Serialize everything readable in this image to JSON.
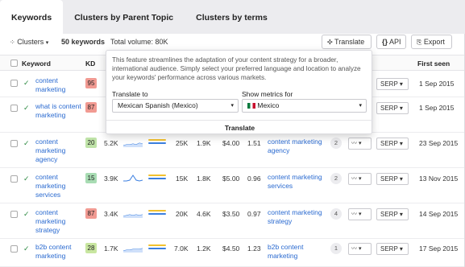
{
  "tabs": [
    {
      "label": "Keywords",
      "active": true
    },
    {
      "label": "Clusters by Parent Topic",
      "active": false
    },
    {
      "label": "Clusters by terms",
      "active": false
    }
  ],
  "toolbar": {
    "clusters_label": "Clusters",
    "keywords_count": "50 keywords",
    "total_volume": "Total volume: 80K",
    "translate_label": "Translate",
    "api_label": "API",
    "export_label": "Export"
  },
  "columns": {
    "keyword": "Keyword",
    "kd": "KD",
    "first_seen": "First seen"
  },
  "rows": [
    {
      "keyword": "content marketing",
      "kd": "95",
      "kd_color": "#f19a92",
      "volume": "",
      "clicks": "",
      "cps": "",
      "cpc": "",
      "parent": "",
      "parent_count": "",
      "serp": "SERP",
      "date": "1 Sep 2015"
    },
    {
      "keyword": "what is content marketing",
      "kd": "87",
      "kd_color": "#f19a92",
      "volume": "",
      "clicks": "",
      "cps": "",
      "cpc": "",
      "parent": "",
      "parent_count": "",
      "serp": "SERP",
      "date": "1 Sep 2015"
    },
    {
      "keyword": "content marketing agency",
      "kd": "20",
      "kd_color": "#bfe3a8",
      "cpc_val": "5.2K",
      "volume": "25K",
      "clicks": "1.9K",
      "cpc": "$4.00",
      "cps": "1.51",
      "parent": "content marketing agency",
      "parent_count": "2",
      "serp": "SERP",
      "date": "23 Sep 2015"
    },
    {
      "keyword": "content marketing services",
      "kd": "15",
      "kd_color": "#a8dcb3",
      "cpc_val": "3.9K",
      "volume": "15K",
      "clicks": "1.8K",
      "cpc": "$5.00",
      "cps": "0.96",
      "parent": "content marketing services",
      "parent_count": "2",
      "serp": "SERP",
      "date": "13 Nov 2015"
    },
    {
      "keyword": "content marketing strategy",
      "kd": "87",
      "kd_color": "#f19a92",
      "cpc_val": "3.4K",
      "volume": "20K",
      "clicks": "4.6K",
      "cpc": "$3.50",
      "cps": "0.97",
      "parent": "content marketing strategy",
      "parent_count": "4",
      "serp": "SERP",
      "date": "14 Sep 2015"
    },
    {
      "keyword": "b2b content marketing",
      "kd": "28",
      "kd_color": "#c8e6a0",
      "cpc_val": "1.7K",
      "volume": "7.0K",
      "clicks": "1.2K",
      "cpc": "$4.50",
      "cps": "1.23",
      "parent": "b2b content marketing",
      "parent_count": "1",
      "serp": "SERP",
      "date": "17 Sep 2015"
    }
  ],
  "popup": {
    "description": "This feature streamlines the adaptation of your content strategy for a broader, international audience. Simply select your preferred language and location to analyze your keywords' performance across various markets.",
    "translate_to_label": "Translate to",
    "translate_to_value": "Mexican Spanish (Mexico)",
    "show_metrics_label": "Show metrics for",
    "show_metrics_value": "Mexico",
    "footer_button": "Translate"
  },
  "colors": {
    "link": "#2a6ad0",
    "check": "#2d8a42",
    "sparkline": "#3b7fe0",
    "bar_yellow": "#f2c12e",
    "bar_blue": "#3b7fe0"
  }
}
